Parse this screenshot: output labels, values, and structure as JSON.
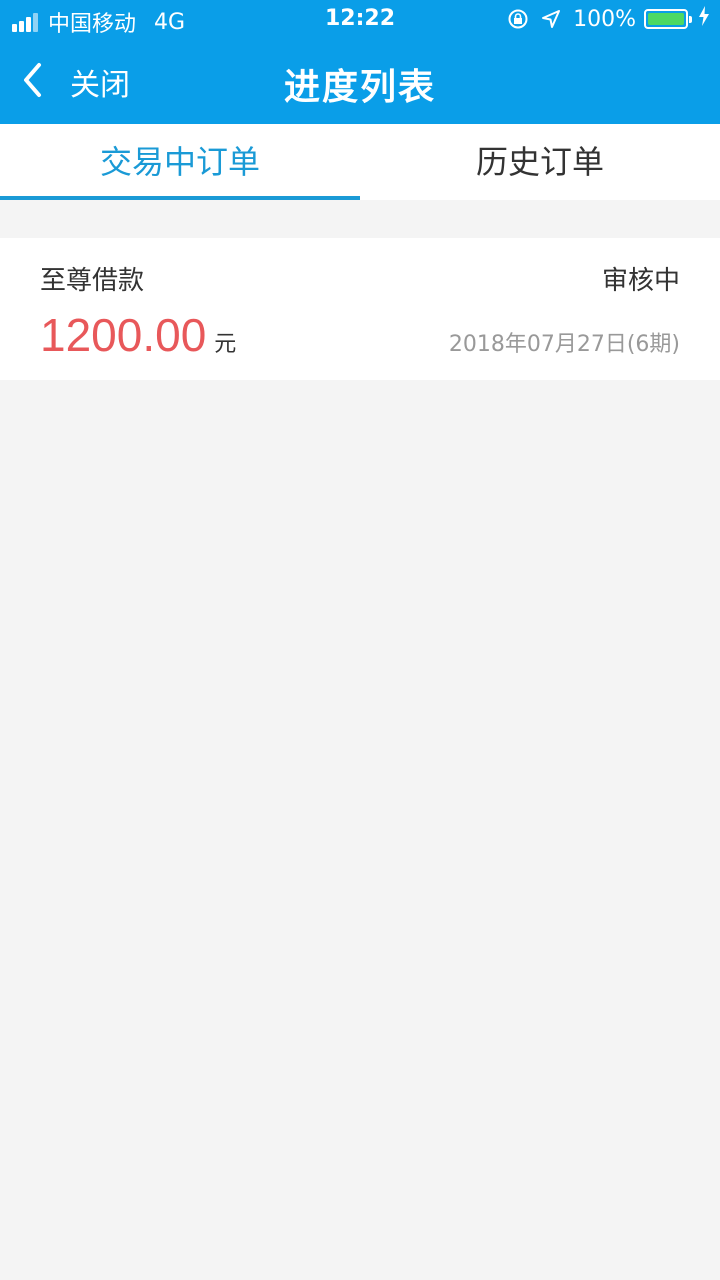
{
  "status_bar": {
    "carrier": "中国移动",
    "network": "4G",
    "time": "12:22",
    "battery": "100%",
    "icons": [
      "signal-icon",
      "rotation-lock-icon",
      "location-arrow-icon",
      "battery-icon",
      "charging-bolt-icon"
    ]
  },
  "nav": {
    "back_label": "关闭",
    "title": "进度列表"
  },
  "tabs": [
    {
      "label": "交易中订单",
      "active": true
    },
    {
      "label": "历史订单",
      "active": false
    }
  ],
  "orders": [
    {
      "product": "至尊借款",
      "status": "审核中",
      "amount": "1200.00",
      "currency": "元",
      "date": "2018年07月27日(6期)"
    }
  ],
  "colors": {
    "header": "#0a9ee8",
    "tab_active": "#1a9ad6",
    "amount": "#e8585a",
    "background": "#f4f4f4"
  }
}
